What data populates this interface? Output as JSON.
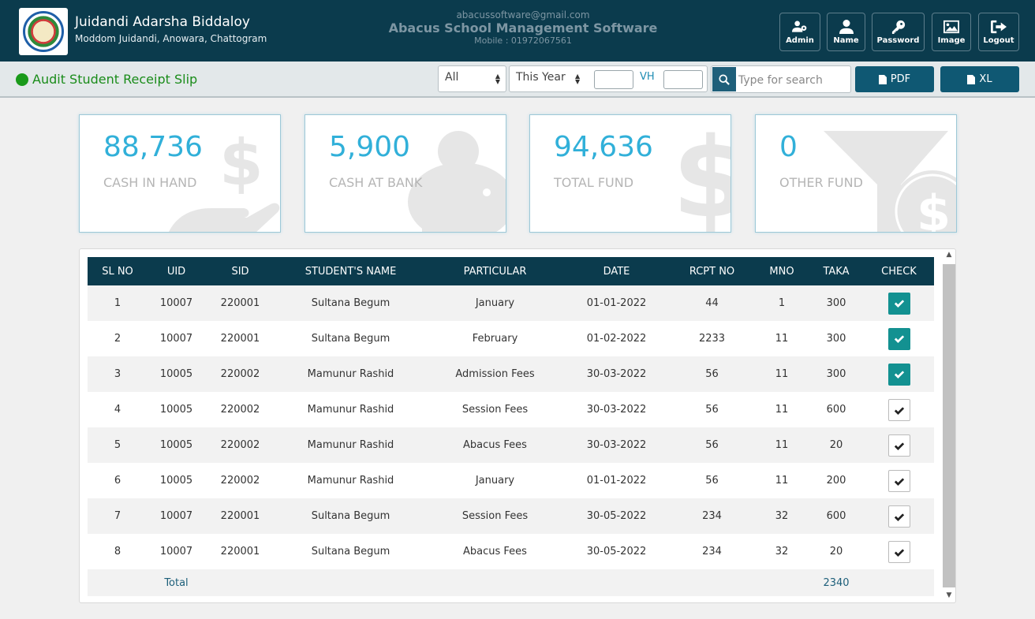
{
  "header": {
    "school_name": "Juidandi Adarsha Biddaloy",
    "school_address": "Moddom Juidandi, Anowara, Chattogram",
    "email": "abacussoftware@gmail.com",
    "software_name": "Abacus School Management Software",
    "mobile": "Mobile : 01972067561",
    "buttons": [
      {
        "label": "Admin",
        "icon": "users-gear-icon"
      },
      {
        "label": "Name",
        "icon": "user-icon"
      },
      {
        "label": "Password",
        "icon": "key-icon"
      },
      {
        "label": "Image",
        "icon": "image-icon"
      },
      {
        "label": "Logout",
        "icon": "logout-icon"
      }
    ]
  },
  "toolbar": {
    "title": "Audit Student Receipt Slip",
    "filter_all": "All",
    "filter_period": "This Year",
    "vh_label": "VH",
    "search_placeholder": "Type for search",
    "pdf_label": "PDF",
    "xl_label": "XL"
  },
  "cards": [
    {
      "value": "88,736",
      "label": "CASH IN HAND",
      "icon": "hand-dollar-icon"
    },
    {
      "value": "5,900",
      "label": "CASH AT BANK",
      "icon": "piggy-bank-icon"
    },
    {
      "value": "94,636",
      "label": "TOTAL FUND",
      "icon": "dollar-icon"
    },
    {
      "value": "0",
      "label": "OTHER FUND",
      "icon": "funnel-dollar-icon"
    }
  ],
  "table": {
    "columns": [
      "SL NO",
      "UID",
      "SID",
      "STUDENT'S NAME",
      "PARTICULAR",
      "DATE",
      "RCPT NO",
      "MNO",
      "TAKA",
      "CHECK"
    ],
    "rows": [
      {
        "sl": "1",
        "uid": "10007",
        "sid": "220001",
        "name": "Sultana Begum",
        "particular": "January",
        "date": "01-01-2022",
        "rcpt": "44",
        "mno": "1",
        "taka": "300",
        "checked": true
      },
      {
        "sl": "2",
        "uid": "10007",
        "sid": "220001",
        "name": "Sultana Begum",
        "particular": "February",
        "date": "01-02-2022",
        "rcpt": "2233",
        "mno": "11",
        "taka": "300",
        "checked": true
      },
      {
        "sl": "3",
        "uid": "10005",
        "sid": "220002",
        "name": "Mamunur Rashid",
        "particular": "Admission Fees",
        "date": "30-03-2022",
        "rcpt": "56",
        "mno": "11",
        "taka": "300",
        "checked": true
      },
      {
        "sl": "4",
        "uid": "10005",
        "sid": "220002",
        "name": "Mamunur Rashid",
        "particular": "Session Fees",
        "date": "30-03-2022",
        "rcpt": "56",
        "mno": "11",
        "taka": "600",
        "checked": false
      },
      {
        "sl": "5",
        "uid": "10005",
        "sid": "220002",
        "name": "Mamunur Rashid",
        "particular": "Abacus Fees",
        "date": "30-03-2022",
        "rcpt": "56",
        "mno": "11",
        "taka": "20",
        "checked": false
      },
      {
        "sl": "6",
        "uid": "10005",
        "sid": "220002",
        "name": "Mamunur Rashid",
        "particular": "January",
        "date": "01-01-2022",
        "rcpt": "56",
        "mno": "11",
        "taka": "200",
        "checked": false
      },
      {
        "sl": "7",
        "uid": "10007",
        "sid": "220001",
        "name": "Sultana Begum",
        "particular": "Session Fees",
        "date": "30-05-2022",
        "rcpt": "234",
        "mno": "32",
        "taka": "600",
        "checked": false
      },
      {
        "sl": "8",
        "uid": "10007",
        "sid": "220001",
        "name": "Sultana Begum",
        "particular": "Abacus Fees",
        "date": "30-05-2022",
        "rcpt": "234",
        "mno": "32",
        "taka": "20",
        "checked": false
      }
    ],
    "footer": {
      "label": "Total",
      "total_taka": "2340"
    }
  },
  "colors": {
    "header_bg": "#0b3b4d",
    "accent_teal": "#139191",
    "card_value": "#31b0d9",
    "title_green": "#1a8c1a"
  }
}
